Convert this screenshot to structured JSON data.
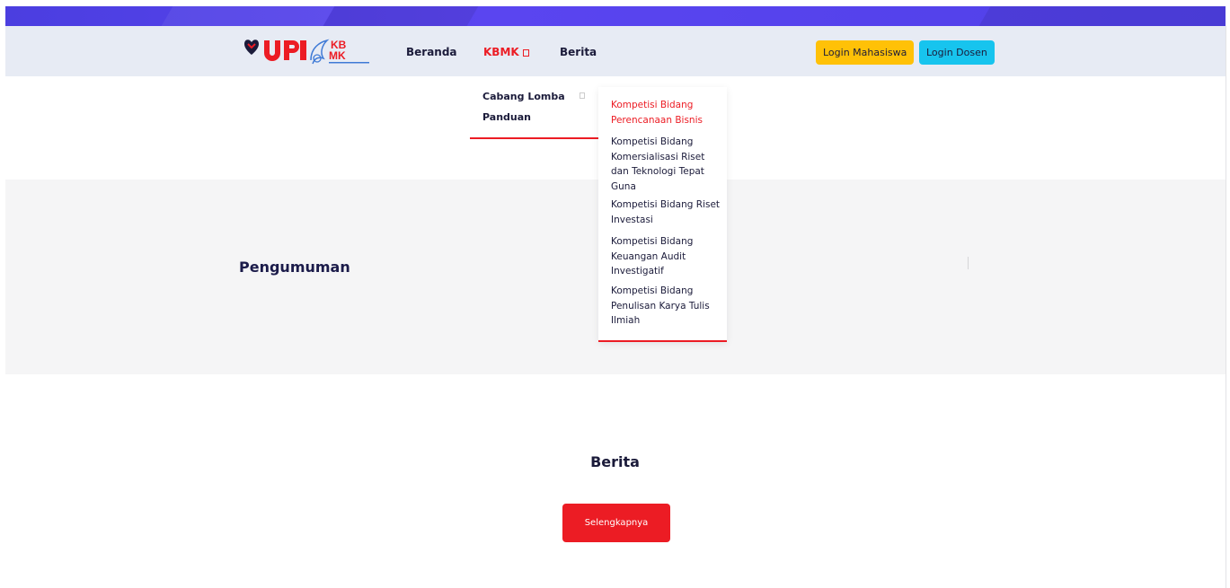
{
  "brand": {
    "logo_text": "UPI",
    "logo_sub": "KB MK",
    "colors": {
      "purple": "#4b3ee0",
      "red": "#ec1c24",
      "yellow": "#ffc107",
      "cyan": "#17c4ee"
    }
  },
  "nav": {
    "items": [
      {
        "label": "Beranda"
      },
      {
        "label": "KBMK"
      },
      {
        "label": "Berita"
      }
    ],
    "login_mahasiswa": "Login Mahasiswa",
    "login_dosen": "Login Dosen"
  },
  "dropdown": {
    "items": [
      {
        "label": "Cabang Lomba"
      },
      {
        "label": "Panduan"
      }
    ],
    "submenu": [
      {
        "label": "Kompetisi Bidang Perencanaan Bisnis"
      },
      {
        "label": "Kompetisi Bidang Komersialisasi Riset dan Teknologi Tepat Guna"
      },
      {
        "label": "Kompetisi Bidang Riset Investasi"
      },
      {
        "label": "Kompetisi Bidang Keuangan Audit Investigatif"
      },
      {
        "label": "Kompetisi Bidang Penulisan Karya Tulis Ilmiah"
      }
    ]
  },
  "announcement": {
    "title": "Pengumuman"
  },
  "news": {
    "title": "Berita",
    "button_label": "Selengkapnya"
  }
}
